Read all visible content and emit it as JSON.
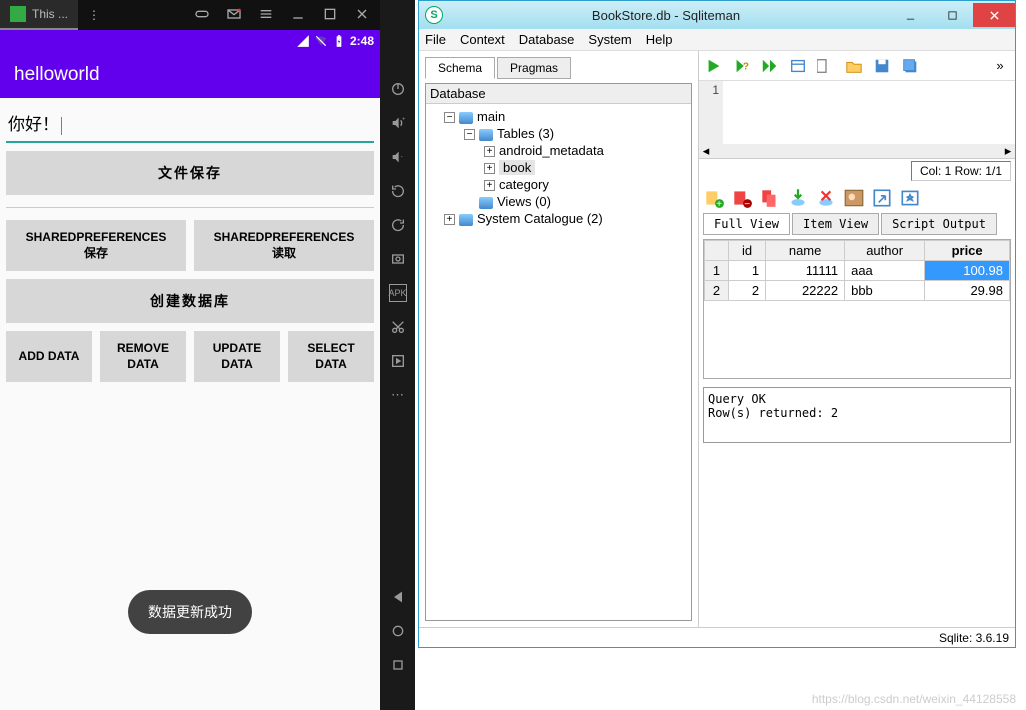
{
  "emulator": {
    "tab_label": "This ...",
    "status_time": "2:48",
    "app_title": "helloworld",
    "input_value": "你好！",
    "btn_save_file": "文件保存",
    "btn_sp_save": "SHAREDPREFERENCES\n保存",
    "btn_sp_read": "SHAREDPREFERENCES\n读取",
    "btn_create_db": "创建数据库",
    "btn_add": "ADD DATA",
    "btn_remove": "REMOVE DATA",
    "btn_update": "UPDATE DATA",
    "btn_select": "SELECT DATA",
    "toast": "数据更新成功"
  },
  "sqliteman": {
    "window_title": "BookStore.db - Sqliteman",
    "menu": [
      "File",
      "Context",
      "Database",
      "System",
      "Help"
    ],
    "left_tabs": [
      "Schema",
      "Pragmas"
    ],
    "tree": {
      "header": "Database",
      "main": "main",
      "tables": "Tables (3)",
      "table_items": [
        "android_metadata",
        "book",
        "category"
      ],
      "views": "Views (0)",
      "syscat": "System Catalogue (2)"
    },
    "editor_line": "1",
    "colrow": "Col: 1 Row: 1/1",
    "result_tabs": [
      "Full View",
      "Item View",
      "Script Output"
    ],
    "grid": {
      "columns": [
        "id",
        "name",
        "author",
        "price"
      ],
      "rows": [
        {
          "n": "1",
          "id": "1",
          "name": "11111",
          "author": "aaa",
          "price": "100.98"
        },
        {
          "n": "2",
          "id": "2",
          "name": "22222",
          "author": "bbb",
          "price": "29.98"
        }
      ]
    },
    "output_line1": "Query OK",
    "output_line2": "Row(s) returned: 2",
    "status": "Sqlite: 3.6.19"
  },
  "watermark": "https://blog.csdn.net/weixin_44128558"
}
